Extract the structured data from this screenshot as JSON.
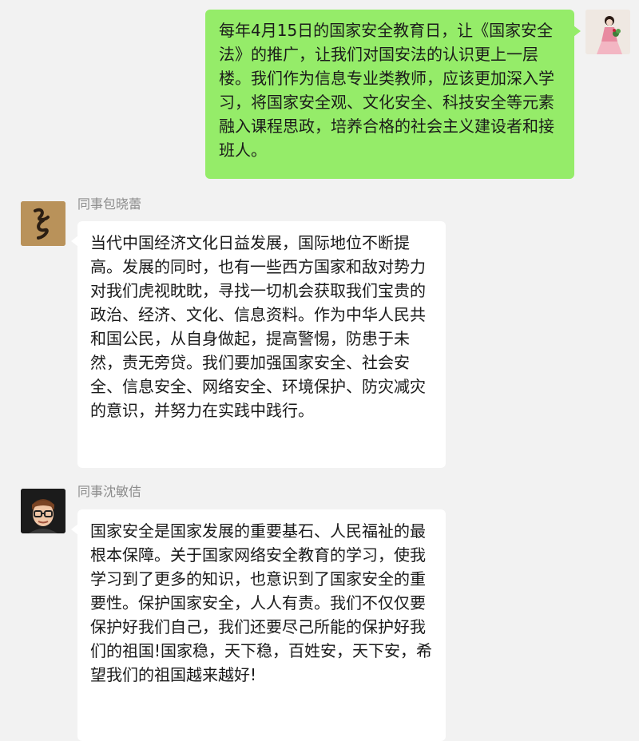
{
  "chat": {
    "messages": [
      {
        "sender": "self",
        "avatar_icon": "woman-in-pink-dress-avatar-icon",
        "text": "每年4月15日的国家安全教育日，让《国家安全法》的推广，让我们对国安法的认识更上一层楼。我们作为信息专业类教师，应该更加深入学习，将国家安全观、文化安全、科技安全等元素融入课程思政，培养合格的社会主义建设者和接班人。"
      },
      {
        "sender": "other",
        "name": "同事包晓蕾",
        "avatar_icon": "calligraphy-avatar-icon",
        "text": "当代中国经济文化日益发展，国际地位不断提高。发展的同时，也有一些西方国家和敌对势力对我们虎视眈眈，寻找一切机会获取我们宝贵的政治、经济、文化、信息资料。作为中华人民共和国公民，从自身做起，提高警惕，防患于未然，责无旁贷。我们要加强国家安全、社会安全、信息安全、网络安全、环境保护、防灾减灾的意识，并努力在实践中践行。"
      },
      {
        "sender": "other",
        "name": "同事沈敏佶",
        "avatar_icon": "cartoon-man-with-glasses-avatar-icon",
        "text": "国家安全是国家发展的重要基石、人民福祉的最根本保障。关于国家网络安全教育的学习，使我学习到了更多的知识，也意识到了国家安全的重要性。保护国家安全，人人有责。我们不仅仅要保护好我们自己，我们还要尽己所能的保护好我们的祖国!国家稳，天下稳，百姓安，天下安，希望我们的祖国越来越好!"
      }
    ]
  },
  "colors": {
    "background": "#f2f2f2",
    "self_bubble": "#95ec69",
    "other_bubble": "#ffffff",
    "sender_name": "#8c8c8c"
  }
}
